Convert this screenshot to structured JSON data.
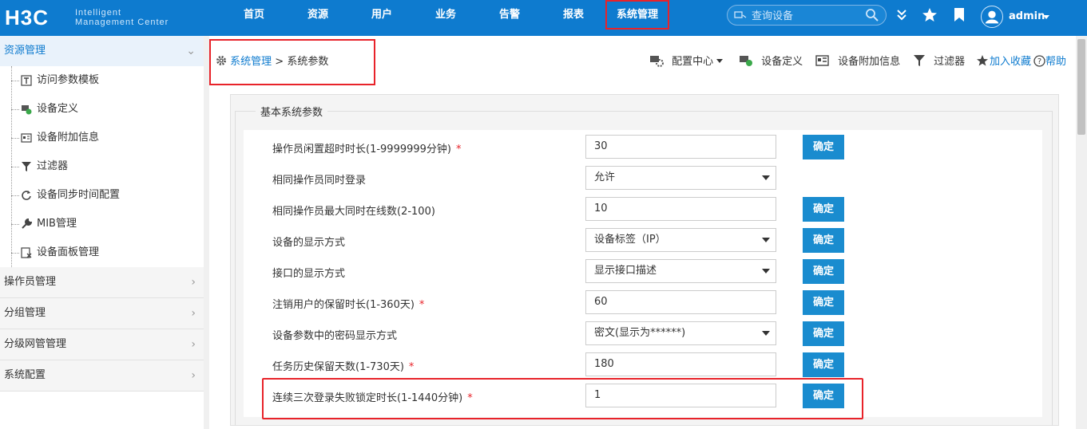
{
  "brand": {
    "logo": "H3C",
    "sub1": "Intelligent",
    "sub2": "Management Center"
  },
  "nav": [
    "首页",
    "资源",
    "用户",
    "业务",
    "告警",
    "报表",
    "系统管理"
  ],
  "search": {
    "placeholder": "查询设备"
  },
  "user": {
    "name": "admin"
  },
  "colors": {
    "topbar": "#0e7bcf",
    "accent": "#1a8ccf",
    "highlight": "#e8232a"
  },
  "sidebar": {
    "open_section": "资源管理",
    "items": [
      {
        "label": "访问参数模板",
        "icon": "template-icon"
      },
      {
        "label": "设备定义",
        "icon": "device-define-icon"
      },
      {
        "label": "设备附加信息",
        "icon": "device-info-icon"
      },
      {
        "label": "过滤器",
        "icon": "filter-icon"
      },
      {
        "label": "设备同步时间配置",
        "icon": "sync-icon"
      },
      {
        "label": "MIB管理",
        "icon": "wrench-icon"
      },
      {
        "label": "设备面板管理",
        "icon": "panel-icon"
      }
    ],
    "sections": [
      "操作员管理",
      "分组管理",
      "分级网管管理",
      "系统配置"
    ]
  },
  "breadcrumb": {
    "root": "系统管理",
    "sep": ">",
    "current": "系统参数"
  },
  "toolbar": {
    "config_center": "配置中心",
    "device_define": "设备定义",
    "device_info": "设备附加信息",
    "filter": "过滤器",
    "favorite": "加入收藏",
    "help": "帮助"
  },
  "form": {
    "legend": "基本系统参数",
    "confirm_label": "确定",
    "rows": [
      {
        "label": "操作员闲置超时时长(1-9999999分钟)",
        "required": "*",
        "value": "30",
        "type": "input",
        "button": true
      },
      {
        "label": "相同操作员同时登录",
        "required": "",
        "value": "允许",
        "type": "select",
        "button": false
      },
      {
        "label": "相同操作员最大同时在线数(2-100)",
        "required": "",
        "value": "10",
        "type": "input",
        "button": true
      },
      {
        "label": "设备的显示方式",
        "required": "",
        "value": "设备标签（IP）",
        "type": "select",
        "button": true
      },
      {
        "label": "接口的显示方式",
        "required": "",
        "value": "显示接口描述",
        "type": "select",
        "button": true
      },
      {
        "label": "注销用户的保留时长(1-360天)",
        "required": "*",
        "value": "60",
        "type": "input",
        "button": true
      },
      {
        "label": "设备参数中的密码显示方式",
        "required": "",
        "value": "密文(显示为******)",
        "type": "select",
        "button": true
      },
      {
        "label": "任务历史保留天数(1-730天)",
        "required": "*",
        "value": "180",
        "type": "input",
        "button": true
      },
      {
        "label": "连续三次登录失败锁定时长(1-1440分钟)",
        "required": "*",
        "value": "1",
        "type": "input",
        "button": true
      }
    ]
  }
}
